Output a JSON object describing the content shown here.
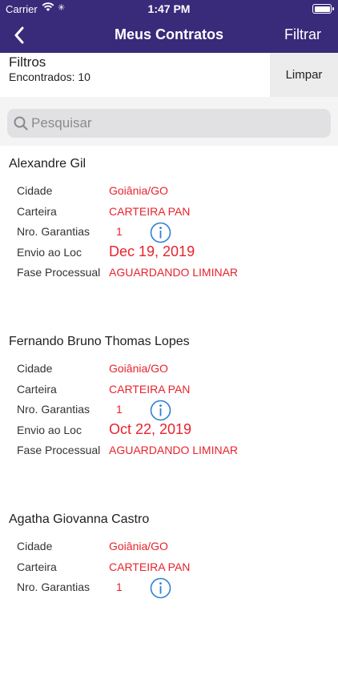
{
  "status_bar": {
    "carrier": "Carrier",
    "time": "1:47 PM"
  },
  "nav": {
    "title": "Meus Contratos",
    "filter_label": "Filtrar"
  },
  "filters": {
    "title": "Filtros",
    "count_text": "Encontrados: 10",
    "clear_label": "Limpar"
  },
  "search": {
    "placeholder": "Pesquisar"
  },
  "labels": {
    "city": "Cidade",
    "portfolio": "Carteira",
    "guarantees": "Nro. Garantias",
    "sent": "Envio ao Loc",
    "phase": "Fase Processual"
  },
  "contracts": [
    {
      "name": "Alexandre Gil",
      "city": "Goiânia/GO",
      "portfolio": "CARTEIRA PAN",
      "guarantees": "1",
      "sent": "Dec 19, 2019",
      "phase": "AGUARDANDO LIMINAR"
    },
    {
      "name": "Fernando Bruno Thomas Lopes",
      "city": "Goiânia/GO",
      "portfolio": "CARTEIRA PAN",
      "guarantees": "1",
      "sent": "Oct 22, 2019",
      "phase": "AGUARDANDO LIMINAR"
    },
    {
      "name": "Agatha Giovanna Castro",
      "city": "Goiânia/GO",
      "portfolio": "CARTEIRA PAN",
      "guarantees": "1"
    }
  ],
  "colors": {
    "nav_bg": "#3a2a7a",
    "value_red": "#e8232d",
    "info_blue": "#2f7fd8"
  },
  "icons": [
    "back-chevron-icon",
    "wifi-icon",
    "battery-icon",
    "search-icon",
    "info-icon"
  ]
}
